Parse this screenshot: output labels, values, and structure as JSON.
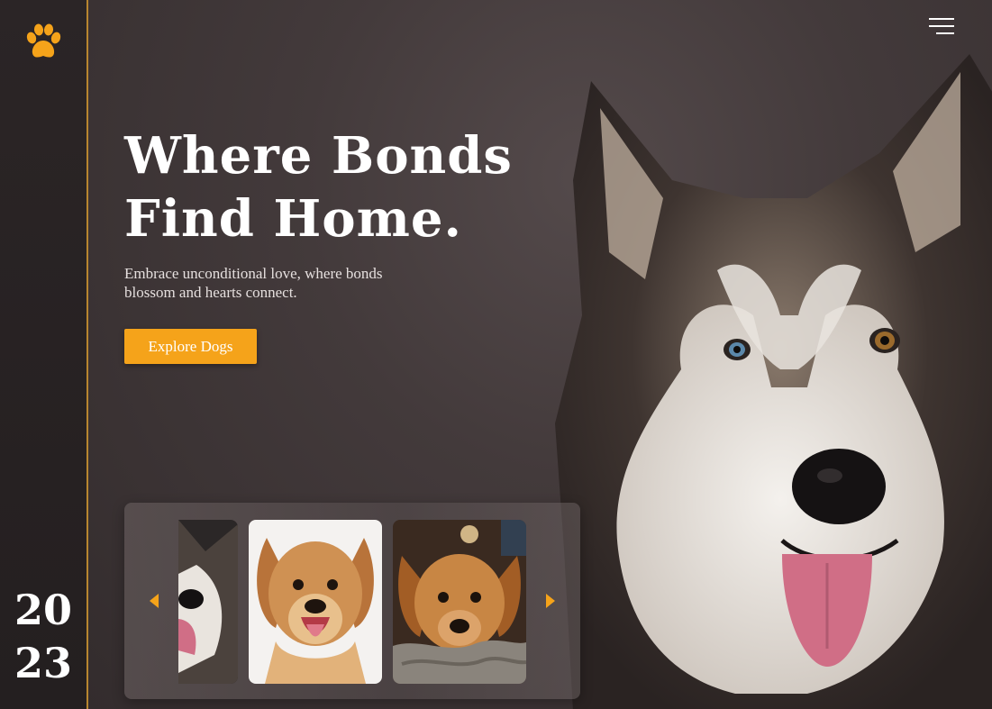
{
  "brand": {
    "logo_icon": "paw-icon",
    "accent_color": "#f5a31a"
  },
  "sidebar": {
    "year_top": "20",
    "year_bottom": "23"
  },
  "header": {
    "menu_icon": "hamburger-menu-icon"
  },
  "hero": {
    "title_line1": "Where Bonds",
    "title_line2": "Find Home.",
    "subtitle_line1": "Embrace unconditional love, where bonds",
    "subtitle_line2": "blossom and hearts connect.",
    "cta_label": "Explore Dogs",
    "image": "husky-photo"
  },
  "carousel": {
    "prev_icon": "arrow-left-icon",
    "next_icon": "arrow-right-icon",
    "items": [
      {
        "image": "husky-thumbnail"
      },
      {
        "image": "golden-puppy-thumbnail"
      },
      {
        "image": "puppy-on-blanket-thumbnail"
      }
    ]
  }
}
